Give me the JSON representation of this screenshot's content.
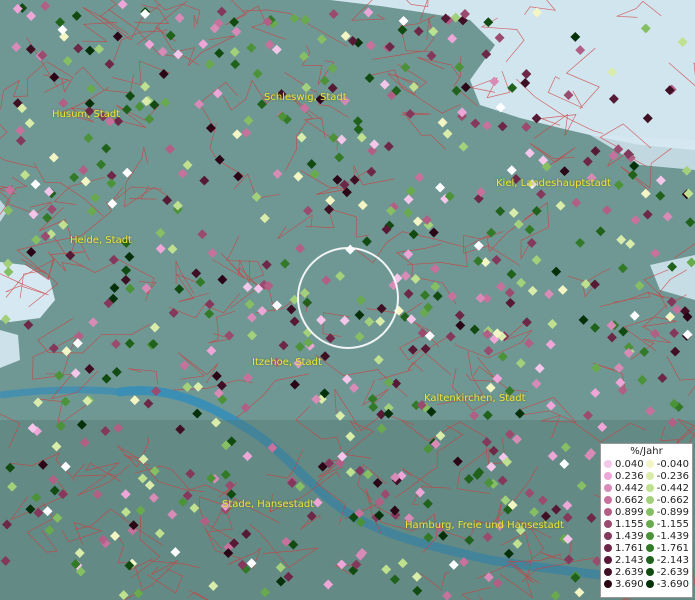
{
  "map": {
    "colors": {
      "land": "#6f9894",
      "sea": "#d6e9f3",
      "river": "#3c8fb4",
      "border": "#d23a3a",
      "label": "#f2e23a"
    },
    "cities": [
      {
        "id": "husum",
        "name": "Husum, Stadt"
      },
      {
        "id": "schleswig",
        "name": "Schleswig, Stadt"
      },
      {
        "id": "kiel",
        "name": "Kiel, Landeshauptstadt"
      },
      {
        "id": "heide",
        "name": "Heide, Stadt"
      },
      {
        "id": "itzehoe",
        "name": "Itzehoe, Stadt"
      },
      {
        "id": "kaltenkirchen",
        "name": "Kaltenkirchen, Stadt"
      },
      {
        "id": "stade",
        "name": "Stade, Hansestadt"
      },
      {
        "id": "hamburg",
        "name": "Hamburg, Freie und Hansestadt"
      }
    ]
  },
  "legend": {
    "title": "%/Jahr",
    "positive": [
      {
        "label": "0.040",
        "color": "#f4c6ea"
      },
      {
        "label": "0.236",
        "color": "#eea6d8"
      },
      {
        "label": "0.442",
        "color": "#d98bb8"
      },
      {
        "label": "0.662",
        "color": "#c7719d"
      },
      {
        "label": "0.899",
        "color": "#b25f86"
      },
      {
        "label": "1.155",
        "color": "#9a4b6e"
      },
      {
        "label": "1.439",
        "color": "#84385b"
      },
      {
        "label": "1.761",
        "color": "#6d2847"
      },
      {
        "label": "2.143",
        "color": "#571a35"
      },
      {
        "label": "2.639",
        "color": "#3f0f24"
      },
      {
        "label": "3.690",
        "color": "#2a0616"
      }
    ],
    "negative": [
      {
        "label": "-0.040",
        "color": "#f3f6c4"
      },
      {
        "label": "-0.236",
        "color": "#d9ecaa"
      },
      {
        "label": "-0.442",
        "color": "#bfe08f"
      },
      {
        "label": "-0.662",
        "color": "#a3d07a"
      },
      {
        "label": "-0.899",
        "color": "#86bf63"
      },
      {
        "label": "-1.155",
        "color": "#68aa4d"
      },
      {
        "label": "-1.439",
        "color": "#4b9239"
      },
      {
        "label": "-1.761",
        "color": "#337a28"
      },
      {
        "label": "-2.143",
        "color": "#20621b"
      },
      {
        "label": "-2.639",
        "color": "#124b12"
      },
      {
        "label": "-3.690",
        "color": "#06300a"
      }
    ]
  }
}
